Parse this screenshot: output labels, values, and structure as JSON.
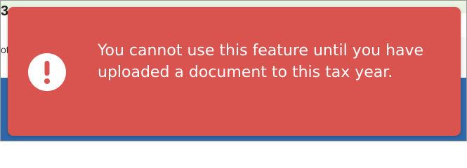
{
  "background": {
    "heading_fragment": "3",
    "subtext_fragment": "ot"
  },
  "toast": {
    "icon": "exclamation-circle-icon",
    "message": "You cannot use this feature until you have uploaded a document to this tax year.",
    "colors": {
      "background": "#d9534f",
      "text": "#ffffff"
    }
  }
}
